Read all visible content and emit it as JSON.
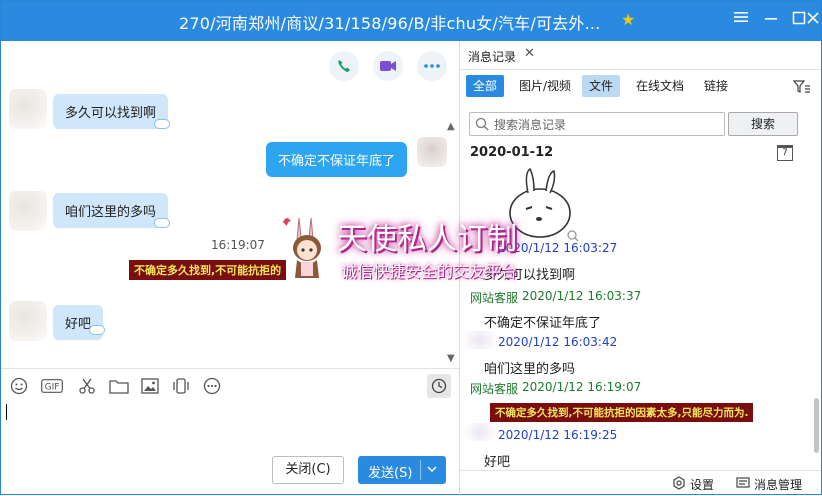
{
  "window": {
    "title": "270/河南郑州/商议/31/158/96/B/非chu女/汽车/可去外...",
    "controls": [
      "settings",
      "minimize",
      "maximize",
      "close"
    ],
    "accent": "#2a8ae0"
  },
  "chat": {
    "top_actions": [
      "phone-icon",
      "video-icon",
      "more-icon"
    ],
    "messages": [
      {
        "side": "left",
        "text": "多久可以找到啊"
      },
      {
        "side": "right",
        "text": "不确定不保证年底了"
      },
      {
        "side": "left",
        "text": "咱们这里的多吗"
      },
      {
        "side": "left",
        "text": "好吧"
      }
    ],
    "time": "16:19:07",
    "warning": "不确定多久找到,不可能抗拒的"
  },
  "toolbar": {
    "icons": [
      "emoji-icon",
      "gif-icon",
      "scissors-icon",
      "folder-icon",
      "image-icon",
      "shake-icon",
      "more-icon",
      "history-clock-icon"
    ],
    "gif_label": "GIF"
  },
  "input": {
    "close_label": "关闭(C)",
    "send_label": "发送(S)"
  },
  "history": {
    "tab_label": "消息记录",
    "filters": [
      "全部",
      "图片/视频",
      "文件",
      "在线文档",
      "链接"
    ],
    "search_placeholder": "搜索消息记录",
    "search_button": "搜索",
    "date": "2020-01-12",
    "records": [
      {
        "sender": "",
        "time": "2020/1/12 16:03:27",
        "text": "多久可以找到啊",
        "color": "blue"
      },
      {
        "sender": "网站客服",
        "time": "2020/1/12 16:03:37",
        "text": "不确定不保证年底了",
        "color": "green"
      },
      {
        "sender": "",
        "time": "2020/1/12 16:03:42",
        "text": "咱们这里的多吗",
        "color": "blue"
      },
      {
        "sender": "网站客服",
        "time": "2020/1/12 16:19:07",
        "text": "不确定多久找到,不可能抗拒的因素太多,只能尽力而为.",
        "color": "green"
      },
      {
        "sender": "",
        "time": "2020/1/12 16:19:25",
        "text": "好吧",
        "color": "blue"
      }
    ],
    "footer_settings": "设置",
    "footer_manage": "消息管理"
  },
  "watermark": {
    "title": "天使私人订制",
    "subtitle": "诚信快捷安全的交友平台"
  }
}
